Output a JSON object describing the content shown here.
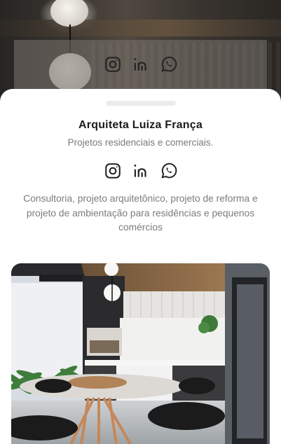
{
  "profile": {
    "name": "Arquiteta Luiza França",
    "tagline": "Projetos residenciais e comerciais.",
    "description": "Consultoria, projeto arquitetônico, projeto de reforma e projeto de ambientação para residências e pequenos comércios"
  },
  "socials": [
    {
      "icon": "instagram-icon"
    },
    {
      "icon": "linkedin-icon"
    },
    {
      "icon": "whatsapp-icon"
    }
  ],
  "colors": {
    "card_background": "#ffffff",
    "title_text": "#1b1b1b",
    "muted_text": "#7a7a7a",
    "icon_stroke": "#222222"
  }
}
